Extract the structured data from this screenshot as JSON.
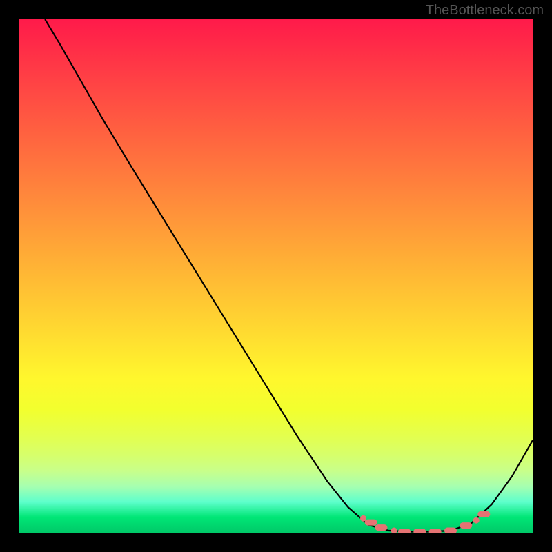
{
  "watermark": "TheBottleneck.com",
  "chart_data": {
    "type": "line",
    "title": "",
    "xlabel": "",
    "ylabel": "",
    "xlim": [
      0,
      100
    ],
    "ylim": [
      0,
      100
    ],
    "grid": false,
    "legend": false,
    "curve": [
      {
        "x": 5,
        "y": 100
      },
      {
        "x": 8,
        "y": 95
      },
      {
        "x": 12,
        "y": 88
      },
      {
        "x": 16,
        "y": 81
      },
      {
        "x": 22,
        "y": 71
      },
      {
        "x": 30,
        "y": 58
      },
      {
        "x": 38,
        "y": 45
      },
      {
        "x": 46,
        "y": 32
      },
      {
        "x": 54,
        "y": 19
      },
      {
        "x": 60,
        "y": 10
      },
      {
        "x": 64,
        "y": 5
      },
      {
        "x": 68,
        "y": 1.5
      },
      {
        "x": 72,
        "y": 0.4
      },
      {
        "x": 76,
        "y": 0.2
      },
      {
        "x": 80,
        "y": 0.2
      },
      {
        "x": 84,
        "y": 0.4
      },
      {
        "x": 88,
        "y": 1.8
      },
      {
        "x": 92,
        "y": 5.5
      },
      {
        "x": 96,
        "y": 11
      },
      {
        "x": 100,
        "y": 18
      }
    ],
    "markers": [
      {
        "x": 67,
        "y": 2.8,
        "shape": "dot"
      },
      {
        "x": 68.5,
        "y": 2.0,
        "shape": "pill"
      },
      {
        "x": 70.5,
        "y": 1.0,
        "shape": "pill"
      },
      {
        "x": 73,
        "y": 0.4,
        "shape": "dot"
      },
      {
        "x": 75,
        "y": 0.2,
        "shape": "pill"
      },
      {
        "x": 78,
        "y": 0.2,
        "shape": "pill"
      },
      {
        "x": 81,
        "y": 0.2,
        "shape": "pill"
      },
      {
        "x": 84,
        "y": 0.4,
        "shape": "pill"
      },
      {
        "x": 87,
        "y": 1.4,
        "shape": "pill"
      },
      {
        "x": 89,
        "y": 2.4,
        "shape": "dot"
      },
      {
        "x": 90.5,
        "y": 3.6,
        "shape": "pill"
      }
    ]
  }
}
